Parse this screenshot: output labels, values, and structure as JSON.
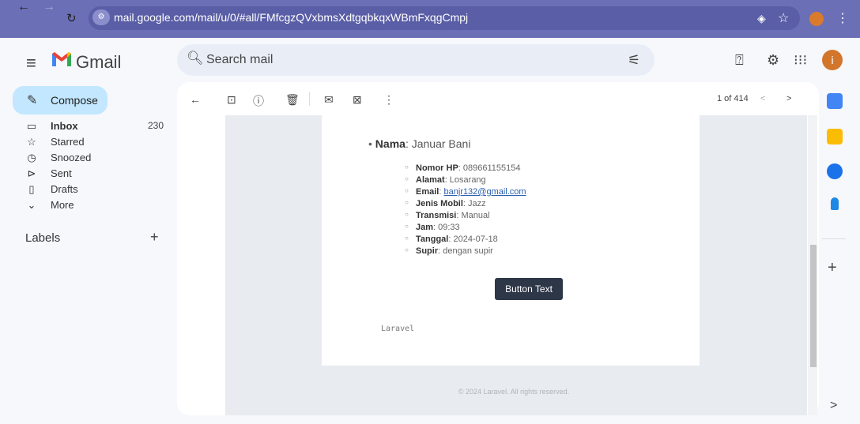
{
  "browser": {
    "url": "mail.google.com/mail/u/0/#all/FMfcgzQVxbmsXdtgqbkqxWBmFxqgCmpj"
  },
  "header": {
    "app_name": "Gmail",
    "search_placeholder": "Search mail",
    "avatar_letter": "i"
  },
  "sidebar": {
    "compose_label": "Compose",
    "items": [
      {
        "label": "Inbox",
        "count": "230"
      },
      {
        "label": "Starred"
      },
      {
        "label": "Snoozed"
      },
      {
        "label": "Sent"
      },
      {
        "label": "Drafts"
      },
      {
        "label": "More"
      }
    ],
    "labels_title": "Labels",
    "labels_add": "+"
  },
  "toolbar": {
    "pager": "1 of 414",
    "prev": "<",
    "next": ">"
  },
  "email": {
    "name_key": "Nama",
    "name_value": ": Januar Bani",
    "details": [
      {
        "key": "Nomor HP",
        "value": ": 089661155154"
      },
      {
        "key": "Alamat",
        "value": ": Losarang"
      },
      {
        "key": "Email",
        "value": ": ",
        "link": "banjr132@gmail.com"
      },
      {
        "key": "Jenis Mobil",
        "value": ": Jazz"
      },
      {
        "key": "Transmisi",
        "value": ": Manual"
      },
      {
        "key": "Jam",
        "value": ": 09:33"
      },
      {
        "key": "Tanggal",
        "value": ": 2024-07-18"
      },
      {
        "key": "Supir",
        "value": ": dengan supir"
      }
    ],
    "button_text": "Button Text",
    "signature": "Laravel",
    "footer": "© 2024 Laravel. All rights reserved."
  },
  "colors": {
    "chrome": "#6b6fb5",
    "compose_bg": "#c2e7ff",
    "button_bg": "#2d3748"
  },
  "right_panel": {
    "add": "+",
    "expand": ">"
  }
}
